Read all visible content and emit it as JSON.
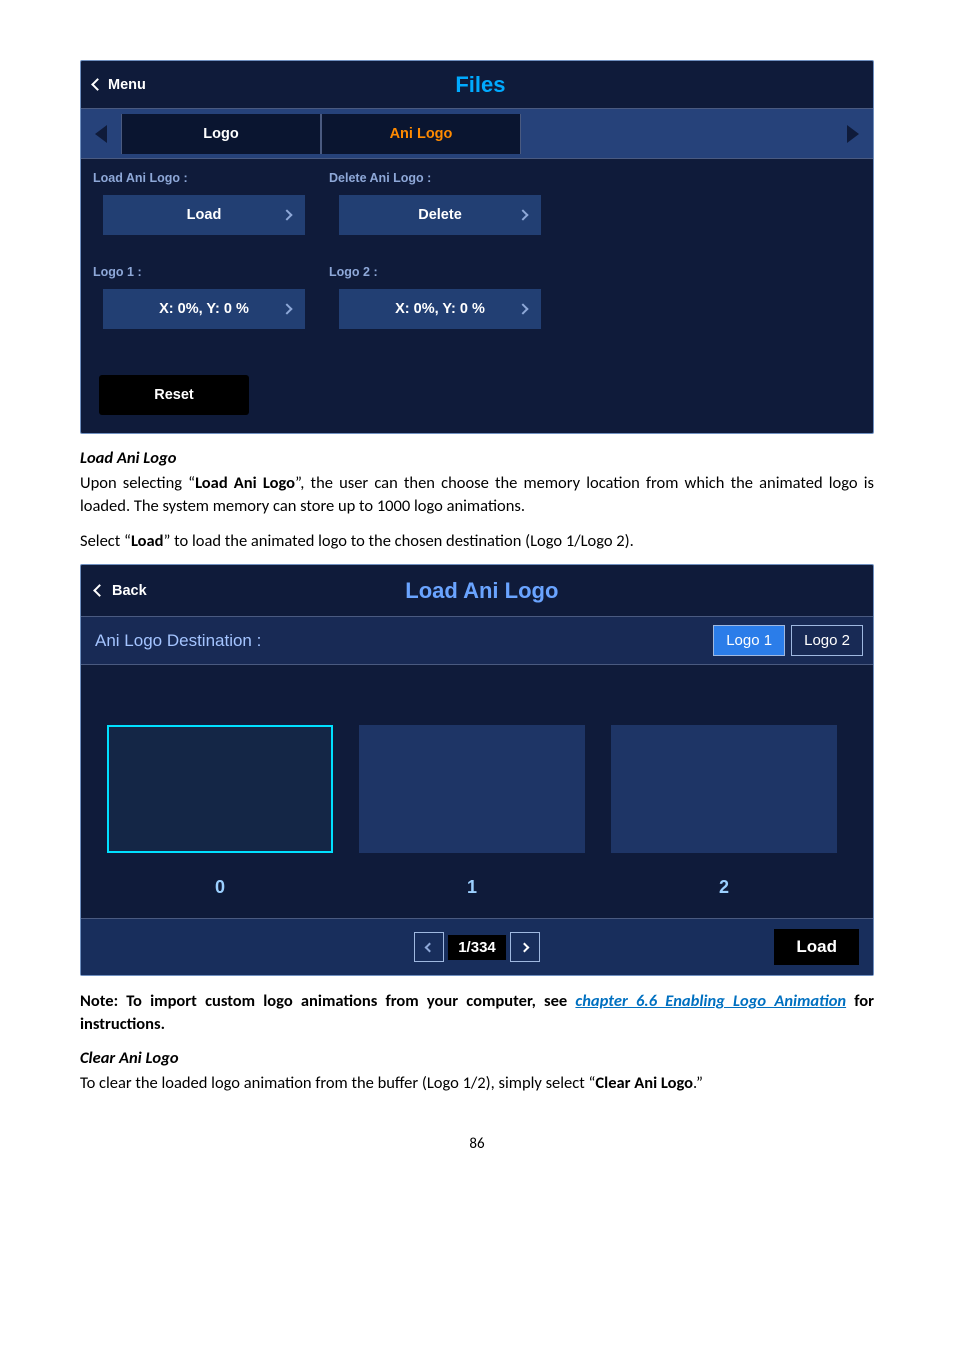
{
  "panel1": {
    "menu_label": "Menu",
    "title": "Files",
    "tabs": {
      "logo": "Logo",
      "ani": "Ani Logo"
    },
    "load_label": "Load Ani Logo :",
    "load_btn": "Load",
    "delete_label": "Delete Ani Logo :",
    "delete_btn": "Delete",
    "logo1_label": "Logo 1 :",
    "logo1_val": "X: 0%, Y: 0 %",
    "logo2_label": "Logo 2 :",
    "logo2_val": "X: 0%, Y: 0 %",
    "reset": "Reset"
  },
  "text": {
    "h1": "Load Ani Logo",
    "p1a": "Upon selecting “",
    "p1b": "Load Ani Logo",
    "p1c": "”, the user can then choose the memory location from which the animated logo is loaded. The system memory can store up to 1000 logo animations.",
    "p2a": "Select “",
    "p2b": "Load",
    "p2c": "” to load the animated logo to the chosen destination (Logo 1/Logo 2).",
    "note_a": "Note: To import custom logo animations from your computer, see ",
    "note_link": "chapter 6.6 Enabling Logo Animation",
    "note_b": " for instructions.",
    "h2": "Clear Ani Logo",
    "p3a": "To clear the loaded logo animation from the buffer (Logo 1/2), simply select “",
    "p3b": "Clear Ani Logo",
    "p3c": ".”"
  },
  "panel2": {
    "back": "Back",
    "title": "Load Ani Logo",
    "dest_label": "Ani Logo Destination :",
    "dest1": "Logo 1",
    "dest2": "Logo 2",
    "thumbs": [
      "0",
      "1",
      "2"
    ],
    "page": "1/334",
    "load": "Load"
  },
  "page_number": "86"
}
